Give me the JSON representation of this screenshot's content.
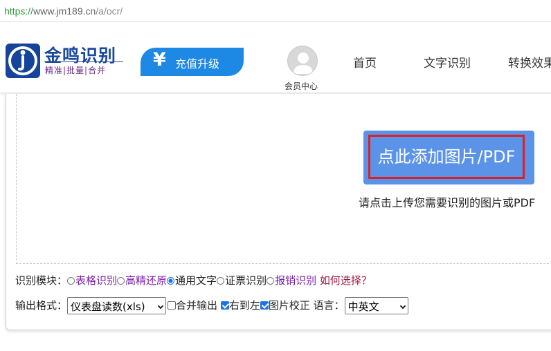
{
  "browser": {
    "url_scheme": "https://",
    "url_host": "www.jm189.cn",
    "url_path": "/a/ocr/"
  },
  "header": {
    "logo_title": "金鸣识别",
    "logo_tagline": "精准|批量|合并",
    "recharge_icon": "¥",
    "recharge_label": "充值升级",
    "member_label": "会员中心",
    "nav": [
      "首页",
      "文字识别",
      "转换效果"
    ]
  },
  "upload": {
    "button_label": "点此添加图片/PDF",
    "hint": "请点击上传您需要识别的图片或PDF"
  },
  "module": {
    "label": "识别模块：",
    "options": [
      "表格识别",
      "高精还原",
      "通用文字",
      "证票识别",
      "报销识别"
    ],
    "selected": "通用文字",
    "help_link": "如何选择？"
  },
  "output": {
    "format_label": "输出格式：",
    "format_value": "仪表盘读数(xls)",
    "merge_label": "合并输出",
    "merge_checked": false,
    "rtl_label": "右到左",
    "rtl_checked": true,
    "correct_label": "图片校正",
    "correct_checked": true,
    "language_label": "语言：",
    "language_value": "中英文"
  },
  "colors": {
    "accent_blue": "#1e88e5",
    "upload_button": "#5b93e8",
    "highlight_border": "#e02020",
    "link_purple": "#7d1fa8",
    "link_maroon": "#a0153e",
    "logo_blue": "#1a49a0"
  }
}
